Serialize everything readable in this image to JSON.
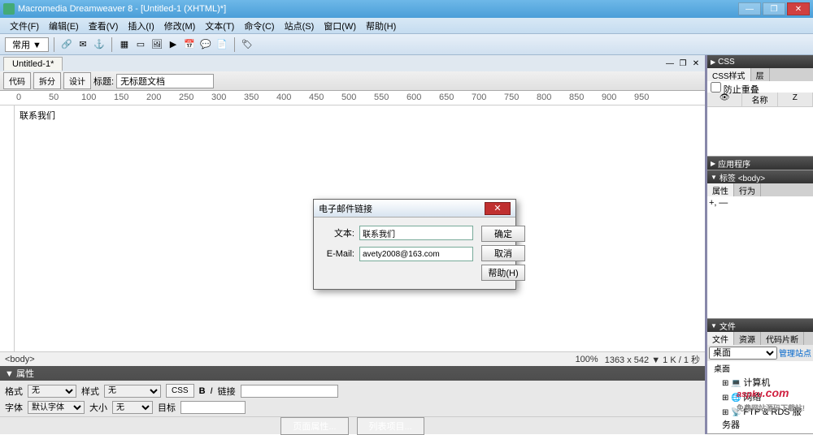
{
  "titlebar": {
    "title": "Macromedia Dreamweaver 8 - [Untitled-1 (XHTML)*]"
  },
  "menubar": [
    "文件(F)",
    "编辑(E)",
    "查看(V)",
    "插入(I)",
    "修改(M)",
    "文本(T)",
    "命令(C)",
    "站点(S)",
    "窗口(W)",
    "帮助(H)"
  ],
  "toolbar": {
    "dropdown": "常用 ▼"
  },
  "doc": {
    "tab": "Untitled-1*",
    "views": [
      "代码",
      "拆分",
      "设计"
    ],
    "title_label": "标题:",
    "title_value": "无标题文档"
  },
  "canvas_text": "联系我们",
  "status": {
    "path": "<body>",
    "zoom": "100%",
    "dims": "1363 x 542 ▼ 1 K / 1 秒"
  },
  "props": {
    "header": "▼ 属性",
    "format_label": "格式",
    "format_value": "无",
    "style_label": "样式",
    "style_value": "无",
    "css_btn": "CSS",
    "link_label": "链接",
    "font_label": "字体",
    "font_value": "默认字体",
    "size_label": "大小",
    "size_value": "无",
    "target_label": "目标",
    "footer_btn1": "页面属性...",
    "footer_btn2": "列表项目..."
  },
  "right": {
    "css_header": "▶ CSS",
    "css_tabs": [
      "CSS样式",
      "层"
    ],
    "col1": "名称",
    "col2": "Z",
    "prevent": "防止重叠",
    "app_header": "▶ 应用程序",
    "tag_header": "▼ 标签 <body>",
    "tag_tabs": [
      "属性",
      "行为"
    ],
    "files_header": "▼ 文件",
    "files_tabs": [
      "文件",
      "资源",
      "代码片断"
    ],
    "site_drop": "桌面",
    "manage": "管理站点",
    "tree": [
      "桌面",
      "计算机",
      "网络",
      "FTP & RDS 服务器"
    ]
  },
  "dialog": {
    "title": "电子邮件链接",
    "text_label": "文本:",
    "text_value": "联系我们",
    "email_label": "E-Mail:",
    "email_value": "avety2008@163.com",
    "ok": "确定",
    "cancel": "取消",
    "help": "帮助(H)"
  },
  "watermark": {
    "main": "aspku",
    "dotcom": ".com",
    "sub": "免费网站源码下载站!"
  }
}
